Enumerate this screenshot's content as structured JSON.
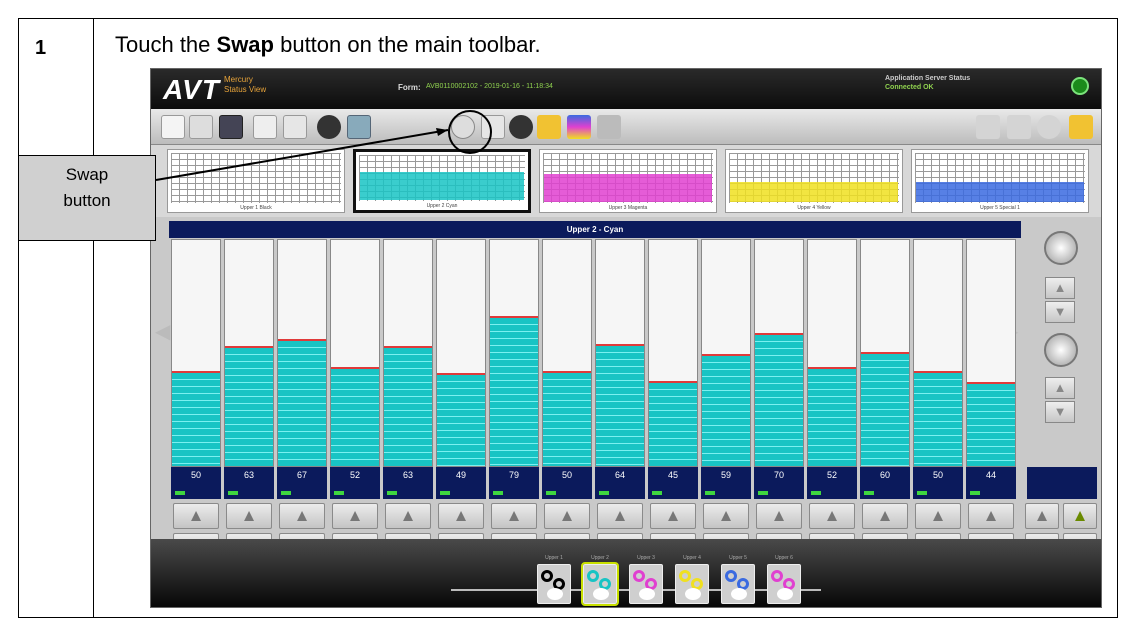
{
  "step": {
    "number": "1",
    "instruction_pre": "Touch the ",
    "instruction_bold": "Swap",
    "instruction_post": " button on the main toolbar."
  },
  "callout": {
    "line1": "Swap",
    "line2": "button"
  },
  "app": {
    "logo": "AVT",
    "logo_sub_1": "Mercury",
    "logo_sub_2": "Status View",
    "form_label": "Form:",
    "form_value": "AVB0110002102 - 2019-01-16 - 11:18:34",
    "server_label": "Application Server Status",
    "server_value": "Connected OK"
  },
  "thumbs": [
    {
      "label": "Upper 1 Black",
      "color": "#bbbbbb"
    },
    {
      "label": "Upper 2 Cyan",
      "color": "#18c4c4"
    },
    {
      "label": "Upper 3 Magenta",
      "color": "#e040d0"
    },
    {
      "label": "Upper 4 Yellow",
      "color": "#f0e020"
    },
    {
      "label": "Upper 5 Special 1",
      "color": "#3a6ae0"
    }
  ],
  "main_title": "Upper 2 - Cyan",
  "channels": [
    {
      "level": 50,
      "label": "50"
    },
    {
      "level": 63,
      "label": "63"
    },
    {
      "level": 67,
      "label": "67"
    },
    {
      "level": 52,
      "label": "52"
    },
    {
      "level": 63,
      "label": "63"
    },
    {
      "level": 49,
      "label": "49"
    },
    {
      "level": 79,
      "label": "79"
    },
    {
      "level": 50,
      "label": "50"
    },
    {
      "level": 64,
      "label": "64"
    },
    {
      "level": 45,
      "label": "45"
    },
    {
      "level": 59,
      "label": "59"
    },
    {
      "level": 70,
      "label": "70"
    },
    {
      "level": 52,
      "label": "52"
    },
    {
      "level": 60,
      "label": "60"
    },
    {
      "level": 50,
      "label": "50"
    },
    {
      "level": 44,
      "label": "44"
    }
  ],
  "footer": {
    "slots": [
      "Upper 1",
      "Upper 2",
      "Upper 3",
      "Upper 4",
      "Upper 5",
      "Upper 6"
    ],
    "slot_colors": [
      "#000000",
      "#18c4c4",
      "#e040d0",
      "#f0e020",
      "#3a6ae0",
      "#e040d0"
    ]
  }
}
